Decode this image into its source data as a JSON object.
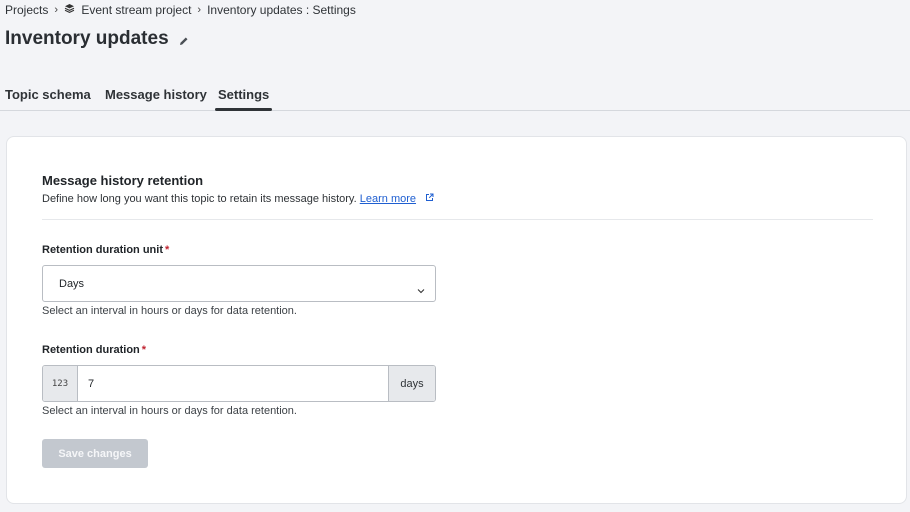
{
  "breadcrumb": {
    "projects": "Projects",
    "project": "Event stream project",
    "current": "Inventory updates : Settings"
  },
  "page": {
    "title": "Inventory updates"
  },
  "tabs": [
    {
      "label": "Topic schema",
      "active": false
    },
    {
      "label": "Message history",
      "active": false
    },
    {
      "label": "Settings",
      "active": true
    }
  ],
  "retention": {
    "title": "Message history retention",
    "description": "Define how long you want this topic to retain its message history.",
    "learn_more": "Learn more",
    "unit_label": "Retention duration unit",
    "required_mark": "*",
    "unit_value": "Days",
    "unit_help": "Select an interval in hours or days for data retention.",
    "duration_label": "Retention duration",
    "duration_prefix": "123",
    "duration_value": "7",
    "duration_suffix": "days",
    "duration_help": "Select an interval in hours or days for data retention.",
    "save_label": "Save changes"
  },
  "icons": {
    "breadcrumb_separator": "chevron-right-icon",
    "project": "project-stack-icon",
    "edit": "pencil-icon",
    "external_link": "external-link-icon",
    "select_caret": "chevron-down-icon"
  },
  "colors": {
    "link": "#1f5fd1",
    "required": "#c02330",
    "disabled_button": "#c3c8cf"
  }
}
